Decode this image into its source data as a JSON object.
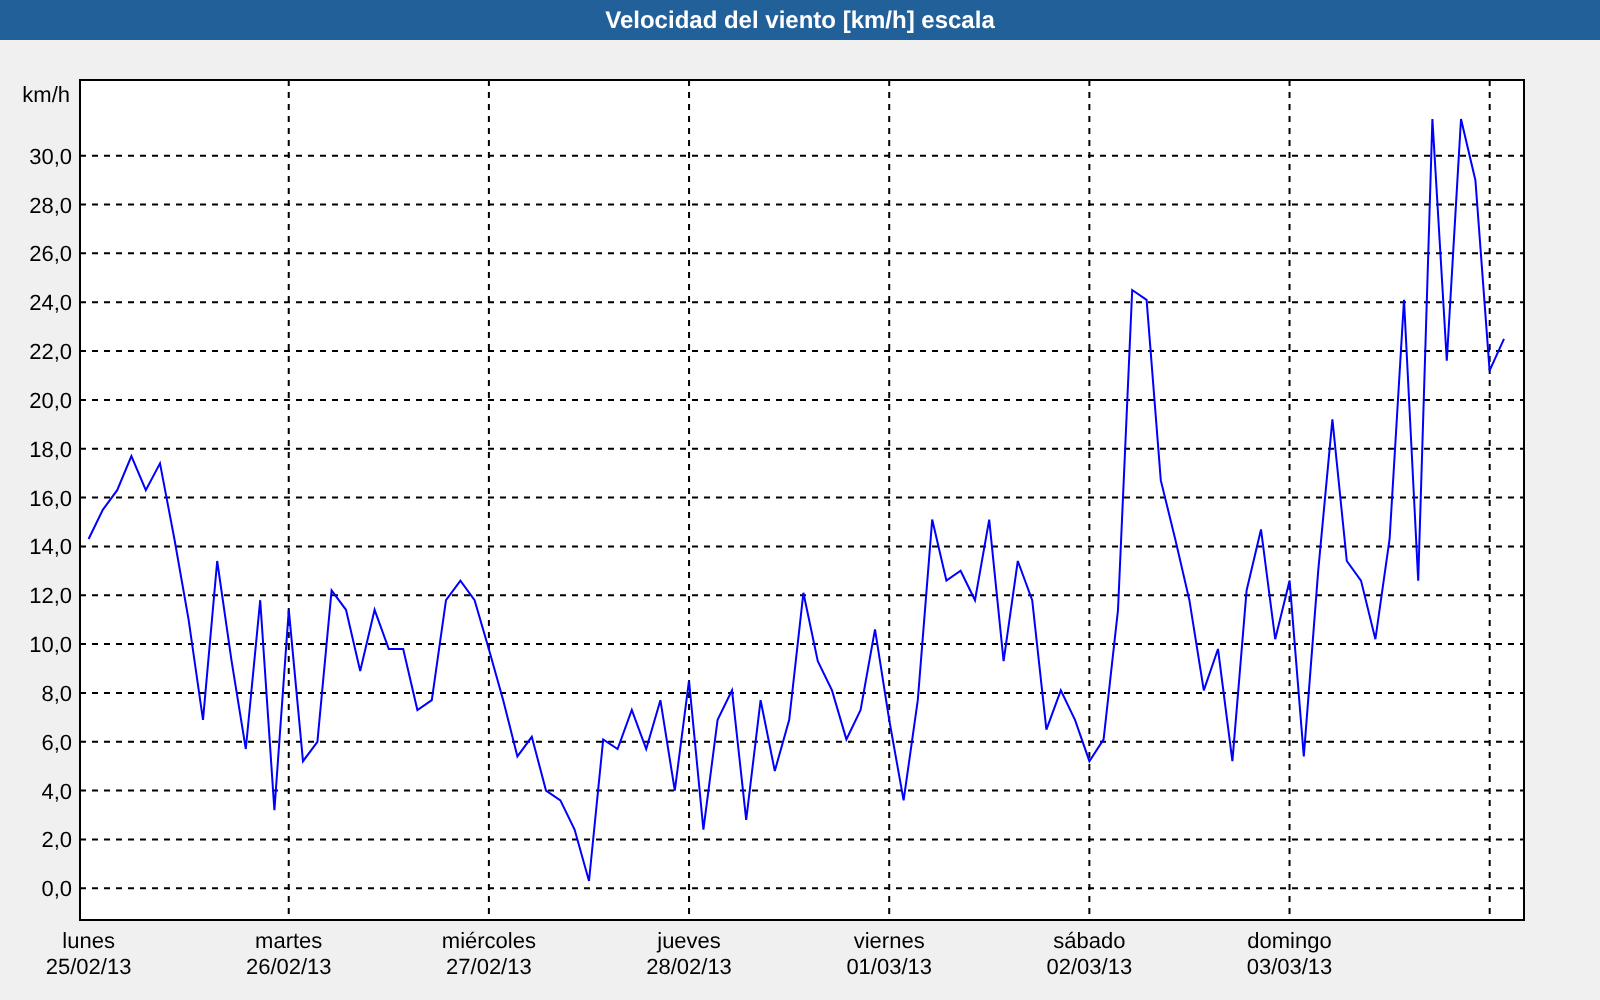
{
  "window": {
    "title": "Velocidad del viento [km/h] escala"
  },
  "chart": {
    "dates": [
      "25/02/13",
      "26/02/13",
      "27/02/13",
      "28/02/13",
      "01/03/13",
      "02/03/13",
      "03/03/13"
    ],
    "chart_data": {
      "type": "line",
      "grid": true,
      "ylabel": "km/h",
      "ylim": [
        -1.3,
        33.1
      ],
      "categories": [
        "lunes",
        null,
        null,
        null,
        null,
        null,
        null,
        null,
        null,
        null,
        null,
        null,
        null,
        null,
        "martes",
        null,
        null,
        null,
        null,
        null,
        null,
        null,
        null,
        null,
        null,
        null,
        null,
        null,
        "miércoles",
        null,
        null,
        null,
        null,
        null,
        null,
        null,
        null,
        null,
        null,
        null,
        null,
        null,
        "jueves",
        null,
        null,
        null,
        null,
        null,
        null,
        null,
        null,
        null,
        null,
        null,
        null,
        null,
        "viernes",
        null,
        null,
        null,
        null,
        null,
        null,
        null,
        null,
        null,
        null,
        null,
        null,
        null,
        "sábado",
        null,
        null,
        null,
        null,
        null,
        null,
        null,
        null,
        null,
        null,
        null,
        null,
        null,
        "domingo",
        null,
        null,
        null,
        null,
        null,
        null,
        null,
        null,
        null,
        null,
        null,
        null,
        null,
        null,
        null
      ],
      "yticks": [
        {
          "value": 0,
          "label": "0,0"
        },
        {
          "value": 2,
          "label": "2,0"
        },
        {
          "value": 4,
          "label": "4,0"
        },
        {
          "value": 6,
          "label": "6,0"
        },
        {
          "value": 8,
          "label": "8,0"
        },
        {
          "value": 10,
          "label": "10,0"
        },
        {
          "value": 12,
          "label": "12,0"
        },
        {
          "value": 14,
          "label": "14,0"
        },
        {
          "value": 16,
          "label": "16,0"
        },
        {
          "value": 18,
          "label": "18,0"
        },
        {
          "value": 20,
          "label": "20,0"
        },
        {
          "value": 22,
          "label": "22,0"
        },
        {
          "value": 24,
          "label": "24,0"
        },
        {
          "value": 26,
          "label": "26,0"
        },
        {
          "value": 28,
          "label": "28,0"
        },
        {
          "value": 30,
          "label": "30,0"
        }
      ],
      "series": [
        {
          "color": "#0000ff",
          "values": [
            14.3,
            15.5,
            16.3,
            17.7,
            16.3,
            17.4,
            14.3,
            11,
            6.9,
            13.4,
            9.3,
            5.7,
            11.8,
            3.2,
            11.4,
            5.2,
            6,
            12.2,
            11.4,
            8.9,
            11.4,
            9.8,
            9.8,
            7.3,
            7.7,
            11.8,
            12.6,
            11.8,
            9.8,
            7.7,
            5.4,
            6.2,
            4,
            3.6,
            2.4,
            0.3,
            6.1,
            5.7,
            7.3,
            5.7,
            7.7,
            4,
            8.5,
            2.4,
            6.9,
            8.1,
            2.8,
            7.7,
            4.8,
            6.9,
            12.1,
            9.3,
            8.1,
            6.1,
            7.3,
            10.6,
            6.9,
            3.6,
            7.7,
            15.1,
            12.6,
            13,
            11.8,
            15.1,
            9.3,
            13.4,
            11.8,
            6.5,
            8.1,
            6.9,
            5.2,
            6.1,
            11.4,
            24.5,
            24.1,
            16.7,
            14.3,
            11.8,
            8.1,
            9.8,
            5.2,
            12.2,
            14.7,
            10.2,
            12.6,
            5.4,
            13,
            19.2,
            13.4,
            12.6,
            10.2,
            14.3,
            24.1,
            12.6,
            31.5,
            21.6,
            31.5,
            29,
            21.2,
            22.5
          ]
        }
      ]
    }
  }
}
